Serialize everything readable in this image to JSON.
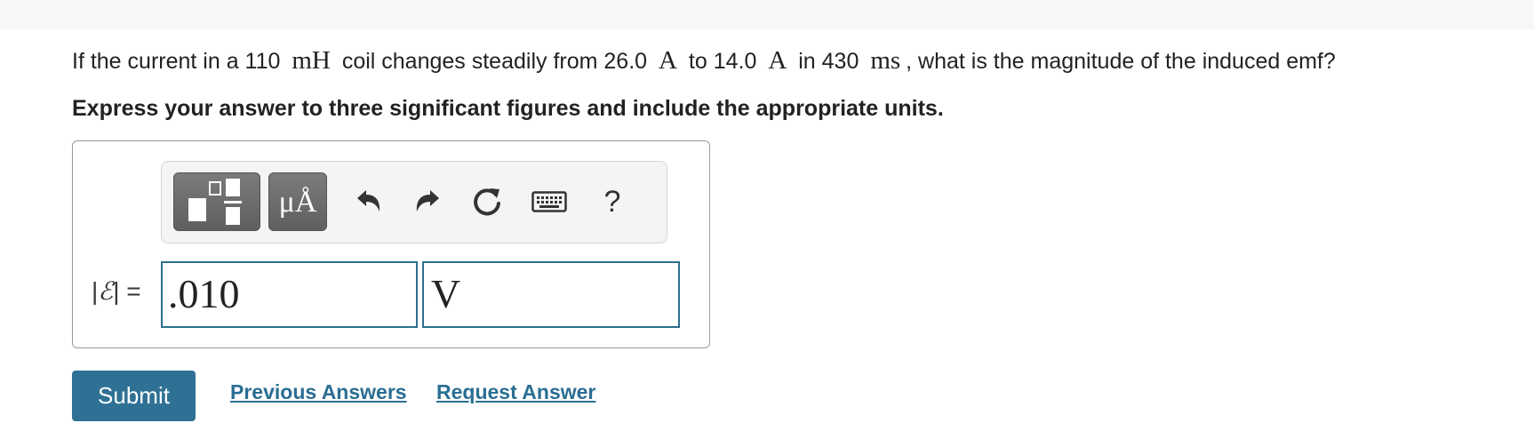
{
  "question": {
    "part1": "If the current in a 110",
    "unit_inductance": "mH",
    "part2": "coil changes steadily from 26.0",
    "unit_current_1": "A",
    "part3": "to 14.0",
    "unit_current_2": "A",
    "part4": "in 430",
    "unit_time": "ms",
    "part5": ", what is the magnitude of the induced emf?"
  },
  "instruction": "Express your answer to three significant figures and include the appropriate units.",
  "toolbar": {
    "templates_icon": "templates-icon",
    "units_label": "μÅ",
    "undo_icon": "undo-icon",
    "redo_icon": "redo-icon",
    "reset_icon": "reset-icon",
    "keyboard_icon": "keyboard-icon",
    "help_label": "?"
  },
  "answer": {
    "label_prefix": "|",
    "label_symbol": "ℰ",
    "label_suffix": "| =",
    "value": ".010",
    "unit": "V"
  },
  "actions": {
    "submit": "Submit",
    "previous_answers": "Previous Answers",
    "request_answer": "Request Answer"
  },
  "colors": {
    "accent": "#2f7195",
    "input_border": "#2e6f8e",
    "link": "#2a6e93",
    "toolbar_button": "#6b6b6b"
  }
}
